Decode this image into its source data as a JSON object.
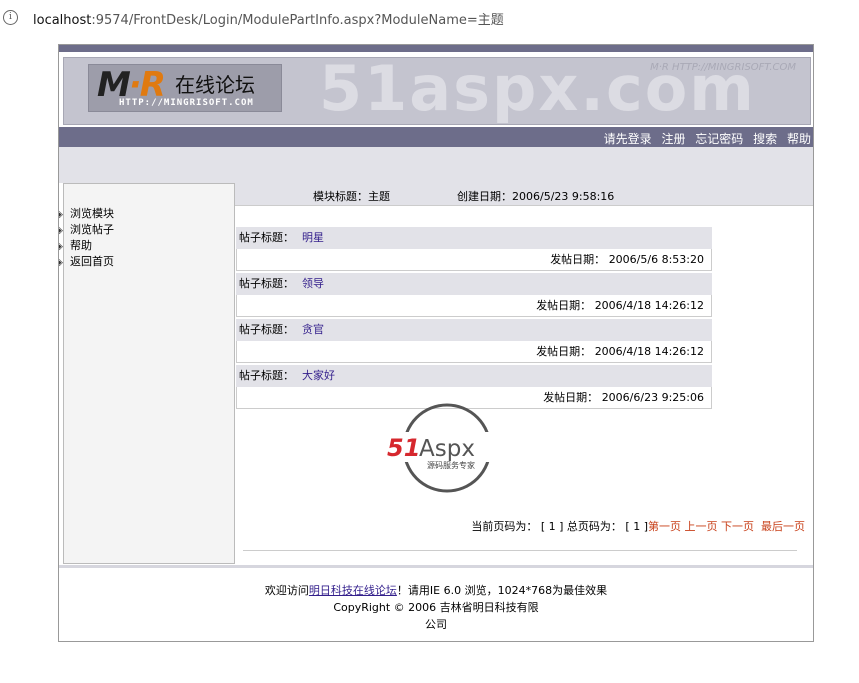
{
  "browser": {
    "url_host": "localhost",
    "url_rest": ":9574/FrontDesk/Login/ModulePartInfo.aspx?ModuleName=主题"
  },
  "banner": {
    "watermark": "51aspx.com",
    "watermark_url": "M·R HTTP://MINGRISOFT.COM",
    "logo_mr_a": "M",
    "logo_mr_b": "·R",
    "logo_cn": "在线论坛",
    "logo_url": "HTTP://MINGRISOFT.COM"
  },
  "nav": {
    "links": [
      "请先登录",
      "注册",
      "忘记密码",
      "搜索",
      "帮助"
    ]
  },
  "sidebar": {
    "items": [
      "浏览模块",
      "浏览帖子",
      "帮助",
      "返回首页"
    ]
  },
  "module": {
    "title_label": "模块标题：",
    "title_value": "主题",
    "created_label": "创建日期：",
    "created_value": "2006/5/23 9:58:16"
  },
  "posts": [
    {
      "title_label": "帖子标题：",
      "title": "明星",
      "date_label": "发帖日期：",
      "date": "2006/5/6 8:53:20"
    },
    {
      "title_label": "帖子标题：",
      "title": "领导",
      "date_label": "发帖日期：",
      "date": "2006/4/18 14:26:12"
    },
    {
      "title_label": "帖子标题：",
      "title": "贪官",
      "date_label": "发帖日期：",
      "date": "2006/4/18 14:26:12"
    },
    {
      "title_label": "帖子标题：",
      "title": "大家好",
      "date_label": "发帖日期：",
      "date": "2006/6/23 9:25:06"
    }
  ],
  "stamp": {
    "brand_a": "51",
    "brand_b": "Aspx",
    "slogan": "源码服务专家"
  },
  "pager": {
    "current_label": "当前页码为：",
    "current": "[ 1 ]",
    "total_label": "总页码为：",
    "total": "[ 1 ]",
    "first": "第一页",
    "prev": "上一页",
    "next": "下一页",
    "last": "最后一页"
  },
  "footer": {
    "pre": "欢迎访问",
    "link": "明日科技在线论坛",
    "post": "！请用IE 6.0 浏览，1024*768为最佳效果",
    "copyright": "CopyRight © 2006 吉林省明日科技有限",
    "company_tail": "公司"
  },
  "colors": {
    "bar": "#6d6d8a",
    "light": "#e2e2e8",
    "post_link": "#331f8c",
    "pager_link": "#c8401a"
  }
}
